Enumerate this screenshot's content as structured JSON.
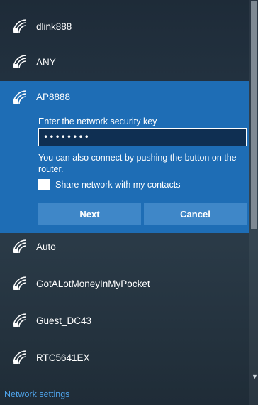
{
  "networks_above": [
    {
      "name": "dlink888"
    },
    {
      "name": "ANY"
    }
  ],
  "expanded": {
    "ssid": "AP8888",
    "prompt": "Enter the network security key",
    "key_value": "••••••••",
    "hint": "You can also connect by pushing the button on the router.",
    "share_label": "Share network with my contacts",
    "share_checked": false,
    "next_label": "Next",
    "cancel_label": "Cancel"
  },
  "networks_below": [
    {
      "name": "Auto"
    },
    {
      "name": "GotALotMoneyInMyPocket"
    },
    {
      "name": "Guest_DC43"
    },
    {
      "name": "RTC5641EX"
    }
  ],
  "footer": {
    "network_settings": "Network settings"
  },
  "colors": {
    "accent": "#1e6db5",
    "button": "#3f87c8",
    "link": "#4fa3ea"
  },
  "icons": {
    "network": "wifi-secured-icon"
  }
}
